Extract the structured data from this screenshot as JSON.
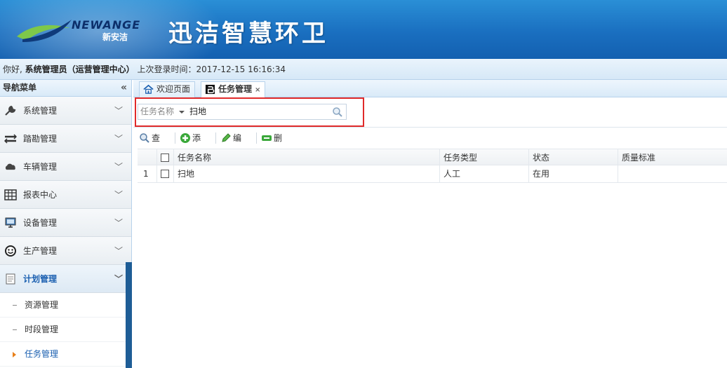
{
  "header": {
    "logo_en": "NEWANGE",
    "logo_cn": "新安洁",
    "app_title": "迅洁智慧环卫"
  },
  "userbar": {
    "greeting": "你好,",
    "user": "系统管理员（运营管理中心）",
    "last_login_label": "上次登录时间：",
    "last_login": "2017-12-15 16:16:34"
  },
  "sidebar": {
    "title": "导航菜单",
    "collapse": "«",
    "items": [
      {
        "label": "系统管理",
        "icon": "wrench-icon"
      },
      {
        "label": "踏勘管理",
        "icon": "arrows-icon"
      },
      {
        "label": "车辆管理",
        "icon": "cloud-icon"
      },
      {
        "label": "报表中心",
        "icon": "table-icon"
      },
      {
        "label": "设备管理",
        "icon": "monitor-icon"
      },
      {
        "label": "生产管理",
        "icon": "smiley-icon"
      },
      {
        "label": "计划管理",
        "icon": "document-icon"
      }
    ],
    "subitems": [
      {
        "label": "资源管理"
      },
      {
        "label": "时段管理"
      },
      {
        "label": "任务管理"
      }
    ]
  },
  "tabs": [
    {
      "label": "欢迎页面",
      "icon": "home-icon"
    },
    {
      "label": "任务管理",
      "icon": "task-icon",
      "close": "×"
    }
  ],
  "search": {
    "category": "任务名称",
    "value": "扫地"
  },
  "toolbar": {
    "view": "查看",
    "add": "添加",
    "edit": "编辑",
    "delete": "删除"
  },
  "grid": {
    "columns": [
      "任务名称",
      "任务类型",
      "状态",
      "质量标准"
    ],
    "rows": [
      {
        "index": "1",
        "name": "扫地",
        "type": "人工",
        "status": "在用",
        "quality": ""
      }
    ]
  },
  "colors": {
    "header_blue": "#1a6fc0",
    "highlight_red": "#e02a2a",
    "active_text": "#1a5fb0"
  }
}
